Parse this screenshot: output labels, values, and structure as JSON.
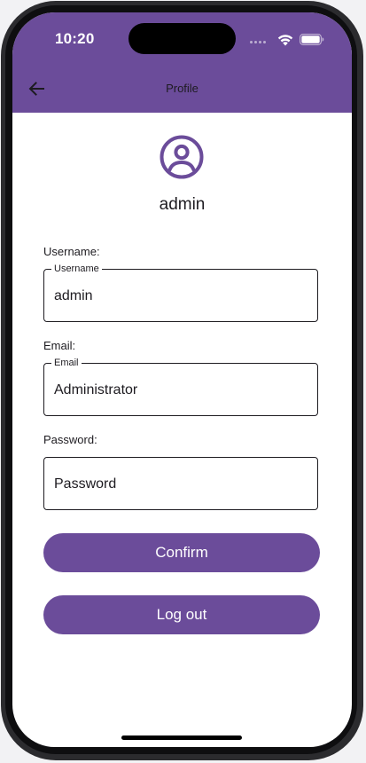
{
  "status_bar": {
    "time": "10:20",
    "wifi_icon": "wifi-icon",
    "battery_icon": "battery-icon"
  },
  "app_bar": {
    "title": "Profile",
    "back_icon": "arrow-left-icon",
    "background_color": "#6b4c9a"
  },
  "profile": {
    "avatar_icon": "account-circle-icon",
    "avatar_color": "#6b4c9a",
    "username_display": "admin"
  },
  "form": {
    "username": {
      "label": "Username:",
      "floating_label": "Username",
      "value": "admin"
    },
    "email": {
      "label": "Email:",
      "floating_label": "Email",
      "value": "Administrator"
    },
    "password": {
      "label": "Password:",
      "placeholder": "Password"
    }
  },
  "actions": {
    "confirm_label": "Confirm",
    "logout_label": "Log out",
    "button_color": "#6b4c9a"
  }
}
